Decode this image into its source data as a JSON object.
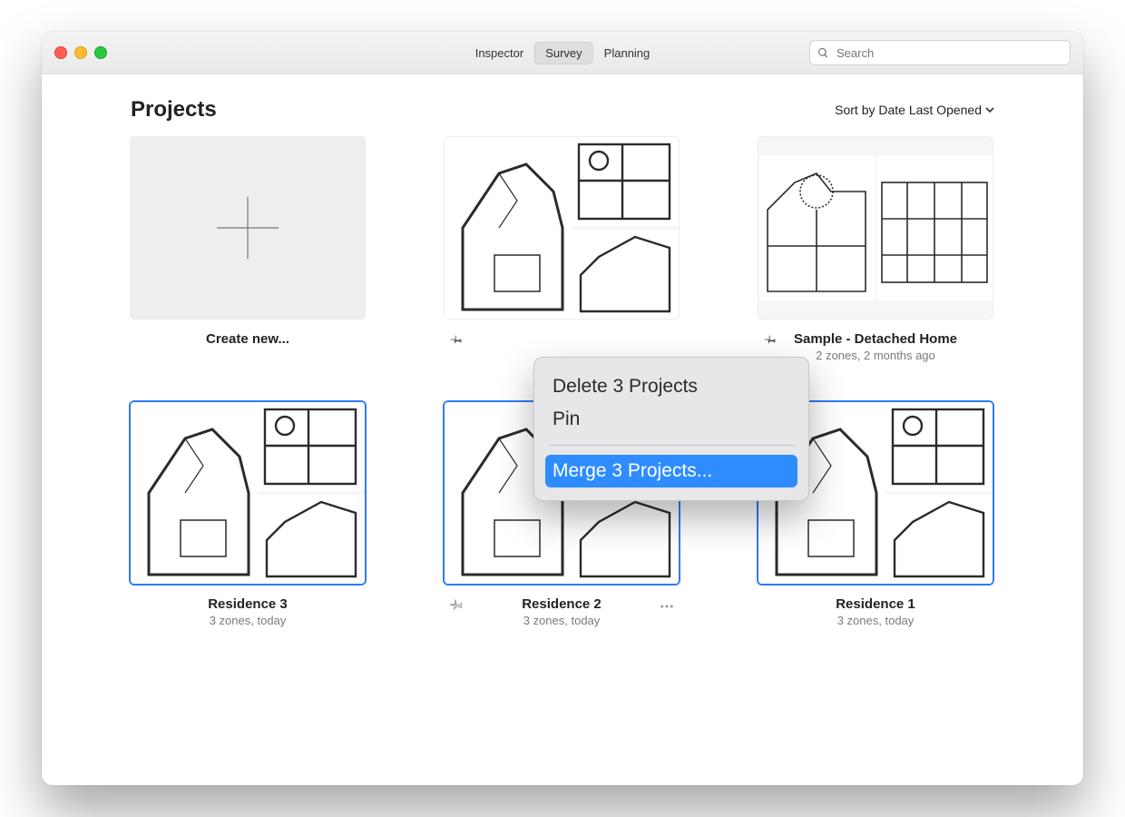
{
  "titlebar": {
    "segments": [
      "Inspector",
      "Survey",
      "Planning"
    ],
    "selected_index": 1,
    "search_placeholder": "Search"
  },
  "header": {
    "title": "Projects",
    "sort_label": "Sort by Date Last Opened"
  },
  "cards": {
    "new_label": "Create new...",
    "items": [
      {
        "title": "",
        "sub": "",
        "pinned": true
      },
      {
        "title": "Sample - Detached Home",
        "sub": "2 zones, 2 months ago",
        "pinned": true
      },
      {
        "title": "Residence 3",
        "sub": "3 zones, today",
        "selected": true
      },
      {
        "title": "Residence 2",
        "sub": "3 zones, today",
        "selected": true,
        "show_pin_outline": true,
        "show_more": true
      },
      {
        "title": "Residence 1",
        "sub": "3 zones, today",
        "selected": true
      }
    ]
  },
  "context_menu": {
    "delete": "Delete 3 Projects",
    "pin": "Pin",
    "merge": "Merge 3 Projects..."
  }
}
